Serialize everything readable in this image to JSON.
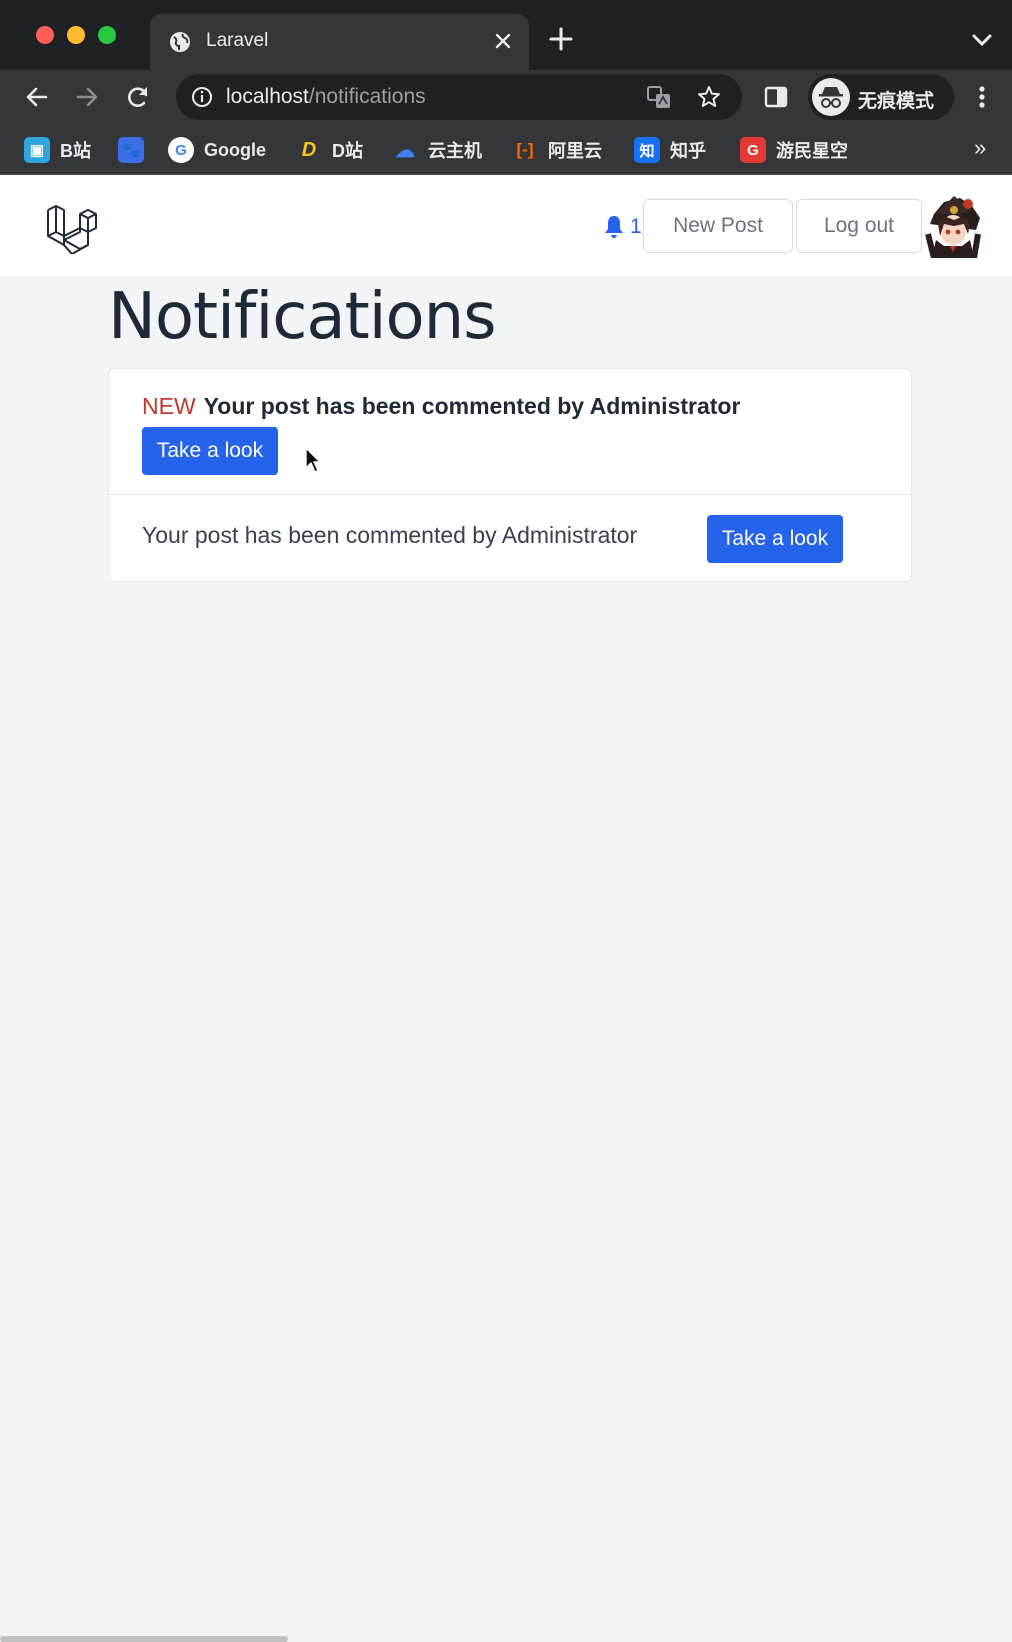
{
  "browser": {
    "tab_title": "Laravel",
    "url_host": "localhost",
    "url_path": "/notifications",
    "incognito_label": "无痕模式",
    "bookmarks": [
      {
        "label": "B站",
        "icon": "bilibili-icon",
        "color": "#2fa7de"
      },
      {
        "label": "",
        "icon": "baidu-icon",
        "color": "#3a6fe8"
      },
      {
        "label": "Google",
        "icon": "google-icon",
        "color": "#ffffff"
      },
      {
        "label": "D站",
        "icon": "d-site-icon",
        "color": "#f5c518"
      },
      {
        "label": "云主机",
        "icon": "cloud-icon",
        "color": "#3b82f6"
      },
      {
        "label": "阿里云",
        "icon": "aliyun-icon",
        "color": "#ff6a00"
      },
      {
        "label": "知乎",
        "icon": "zhihu-icon",
        "color": "#1772f6"
      },
      {
        "label": "游民星空",
        "icon": "gamersky-icon",
        "color": "#e53935"
      }
    ],
    "more_bookmarks": "»"
  },
  "navbar": {
    "notification_count": "1",
    "new_post_label": "New Post",
    "logout_label": "Log out"
  },
  "page": {
    "title": "Notifications",
    "notifications": [
      {
        "badge": "NEW",
        "message": "Your post has been commented by Administrator",
        "action_label": "Take a look",
        "unread": true
      },
      {
        "badge": "",
        "message": "Your post has been commented by Administrator",
        "action_label": "Take a look",
        "unread": false
      }
    ]
  },
  "colors": {
    "primary": "#2563eb",
    "new_badge": "#c0392b",
    "page_bg": "#f3f4f6",
    "chrome_dark": "#202124"
  }
}
